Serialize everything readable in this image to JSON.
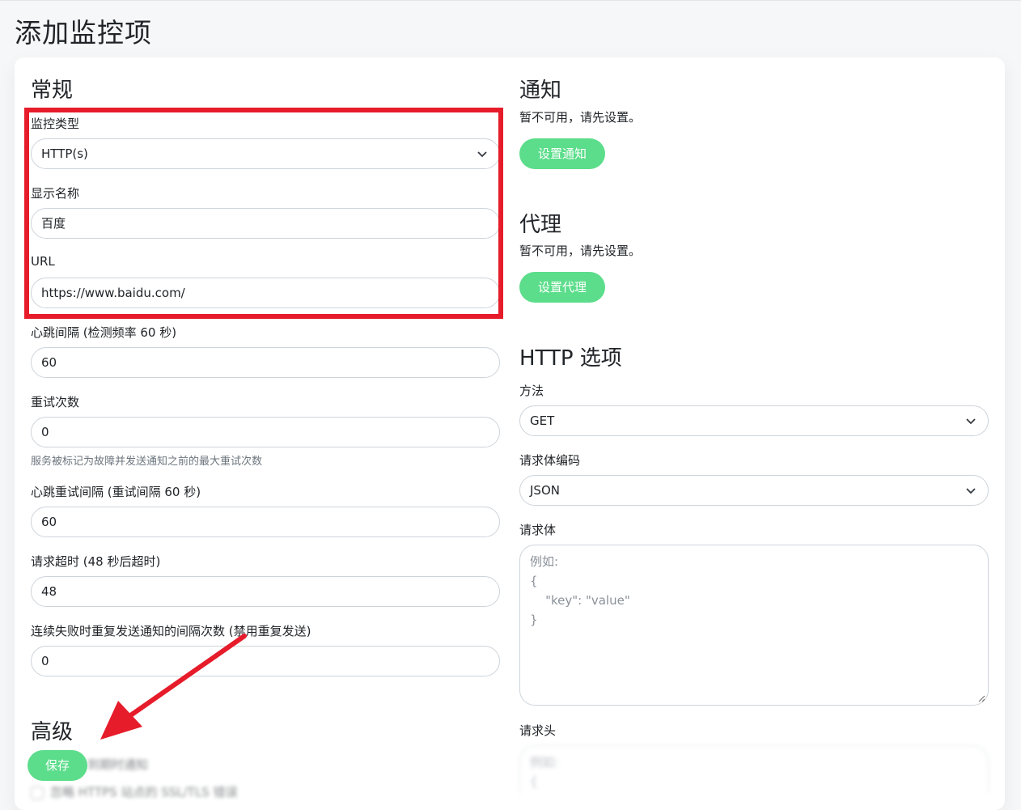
{
  "page": {
    "title": "添加监控项"
  },
  "general": {
    "title": "常规",
    "monitor_type": {
      "label": "监控类型",
      "value": "HTTP(s)"
    },
    "display_name": {
      "label": "显示名称",
      "value": "百度"
    },
    "url": {
      "label": "URL",
      "value": "https://www.baidu.com/"
    },
    "heartbeat_interval": {
      "label": "心跳间隔 (检测频率 60 秒)",
      "value": "60"
    },
    "retries": {
      "label": "重试次数",
      "value": "0",
      "help": "服务被标记为故障并发送通知之前的最大重试次数"
    },
    "retry_interval": {
      "label": "心跳重试间隔 (重试间隔 60 秒)",
      "value": "60"
    },
    "timeout": {
      "label": "请求超时 (48 秒后超时)",
      "value": "48"
    },
    "resend_interval": {
      "label": "连续失败时重复发送通知的间隔次数 (禁用重复发送)",
      "value": "0"
    }
  },
  "advanced": {
    "title": "高级",
    "save_label": "保存",
    "blurred_option_1": "到期时通知",
    "blurred_option_2": "忽略 HTTPS 站点的 SSL/TLS 错误"
  },
  "notifications": {
    "title": "通知",
    "notice": "暂不可用，请先设置。",
    "button": "设置通知"
  },
  "proxy": {
    "title": "代理",
    "notice": "暂不可用，请先设置。",
    "button": "设置代理"
  },
  "http_options": {
    "title": "HTTP 选项",
    "method": {
      "label": "方法",
      "value": "GET"
    },
    "body_encoding": {
      "label": "请求体编码",
      "value": "JSON"
    },
    "body": {
      "label": "请求体",
      "placeholder": "例如:\n{\n    \"key\": \"value\"\n}"
    },
    "headers": {
      "label": "请求头",
      "placeholder": "例如:\n{"
    }
  },
  "colors": {
    "accent": "#5cdd8b",
    "annotation": "#e61c2a"
  }
}
